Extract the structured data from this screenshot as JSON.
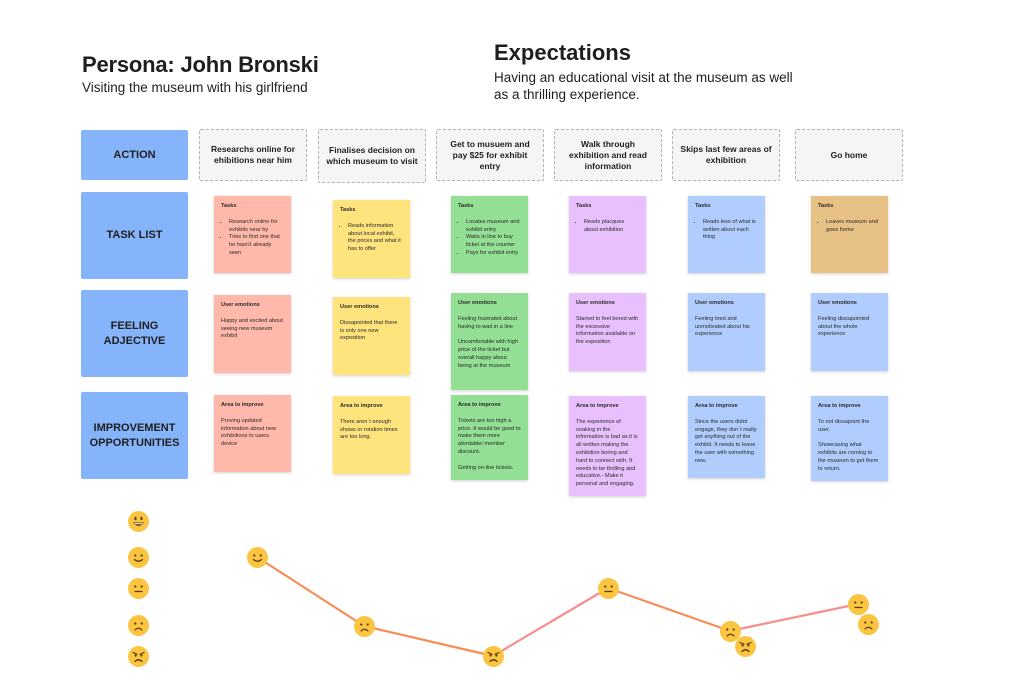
{
  "persona": {
    "title": "Persona: John  Bronski",
    "subtitle": "Visiting the museum with his girlfriend"
  },
  "expectations": {
    "title": "Expectations",
    "text": "Having an educational visit at the museum as well as a thrilling experience."
  },
  "row_labels": {
    "action": "ACTION",
    "task_list": "TASK LIST",
    "feeling": "FEELING ADJECTIVE",
    "improvement": "IMPROVEMENT OPPORTUNITIES"
  },
  "actions": [
    "Researchs online for ehibitions near him",
    "Finalises decision on which museum to visit",
    "Get to musuem and pay $25 for exhibit entry",
    "Walk through exhibition and read information",
    "Skips last few areas of exhibition",
    "Go home"
  ],
  "tasks": {
    "title": "Tasks",
    "items": [
      [
        "Research online for exhibits near by",
        "Tries to find one that he hasn't already seen"
      ],
      [
        "Reads information about local exhibit, the prices and what it has to offer"
      ],
      [
        "Locates museum and exhibit entry",
        "Waits in line to buy ticket at the counter",
        "Pays for exhibit entry"
      ],
      [
        "Reads placques about exhibition"
      ],
      [
        "Reads less of what is written about each thing"
      ],
      [
        "Leaves museum and goes home"
      ]
    ]
  },
  "emotions": {
    "title": "User emotions",
    "items": [
      [
        "Happy and excited about seeing new museum exhibit"
      ],
      [
        "Dissapointed that there is only one new exposition"
      ],
      [
        "Feeling frustrated about having to wait in a line",
        "Uncomfortable with high price of the ticket but overall happy about being at the museum"
      ],
      [
        "Started to feel bored with the excessive information available on the exposition"
      ],
      [
        "Feeling tired and unmotivated about his experience"
      ],
      [
        "Feeling dissapointed about the whole experience"
      ]
    ]
  },
  "improvements": {
    "title": "Area to improve",
    "items": [
      [
        "Proving updated information about new exhibitions to users device"
      ],
      [
        "There aren´t enough shows or rotation times are too long."
      ],
      [
        "Tickets are too high a price. It would be good to make them more afordable/ member discount.",
        "Getting on-line tickets."
      ],
      [
        "The experience of soaking in the information is bad as it is all written making the exhibition boring and hard to connect with. It needs to be thrilling and educative.- Make it personal and engaging."
      ],
      [
        "Since the users didnt engage, they don´t really get anything out of the exhibit. It needs to leave the user with something new."
      ],
      [
        "To not dissapoint the user.",
        "Showcasing what exhibits are coming to the museum to get them to return."
      ]
    ]
  },
  "colors": {
    "stickies": [
      "#ffb8a9",
      "#ffe37c",
      "#93df93",
      "#e7c0fd",
      "#b0cdfd",
      "#b0cdfd"
    ],
    "task_last": "#e8c187",
    "row_label": "#86b4fb",
    "line_orange": "#f98b55",
    "line_pink": "#f78d8d",
    "emoji": "#fbc541"
  },
  "emotion_scale": [
    "grinning",
    "smiling",
    "neutral",
    "frowning",
    "angry"
  ],
  "journey": [
    {
      "step": 1,
      "emotion": "smiling"
    },
    {
      "step": 2,
      "emotion": "frowning"
    },
    {
      "step": 3,
      "emotion": "angry"
    },
    {
      "step": 4,
      "emotion": "neutral"
    },
    {
      "step": 5,
      "emotion": "frowning",
      "secondary": "angry"
    },
    {
      "step": 6,
      "emotion": "neutral",
      "secondary": "frowning"
    }
  ]
}
